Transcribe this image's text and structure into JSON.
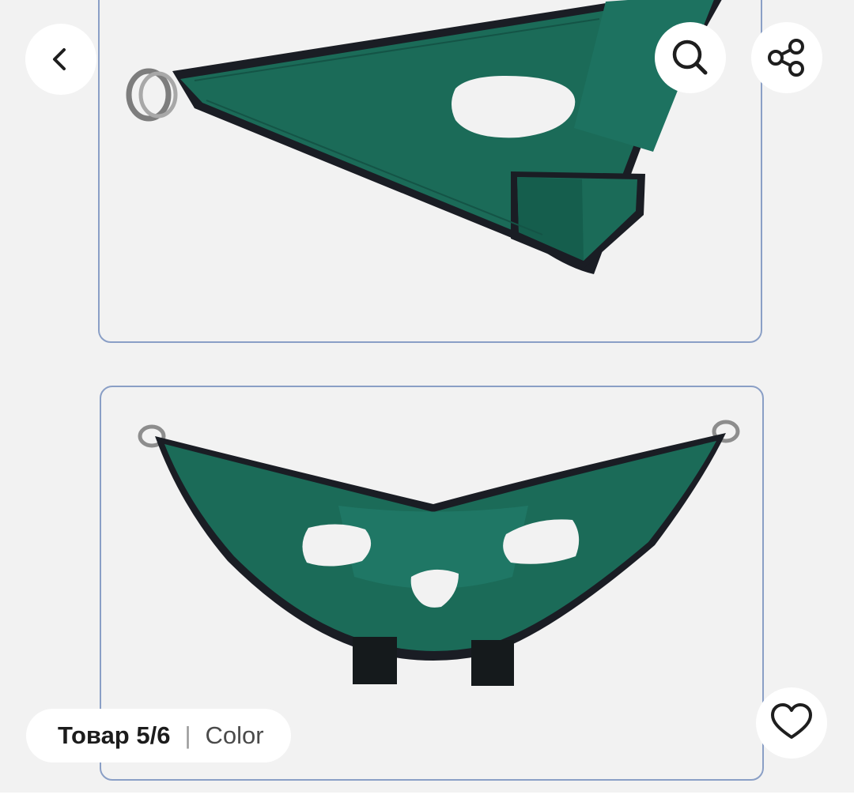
{
  "gallery": {
    "counter": {
      "position": "Товар 5/6",
      "separator": "|",
      "variant": "Color"
    },
    "images": [
      {
        "description_icon": "sling-side-view"
      },
      {
        "description_icon": "sling-front-view"
      }
    ]
  },
  "buttons": {
    "back_icon": "chevron-left-icon",
    "search_icon": "search-icon",
    "share_icon": "share-icon",
    "favorite_icon": "heart-icon"
  },
  "colors": {
    "fabric": "#1b6b58",
    "fabric_dark": "#145446",
    "binding": "#1a1d24",
    "frame_border": "#8a9fc6",
    "background": "#f2f2f2"
  }
}
